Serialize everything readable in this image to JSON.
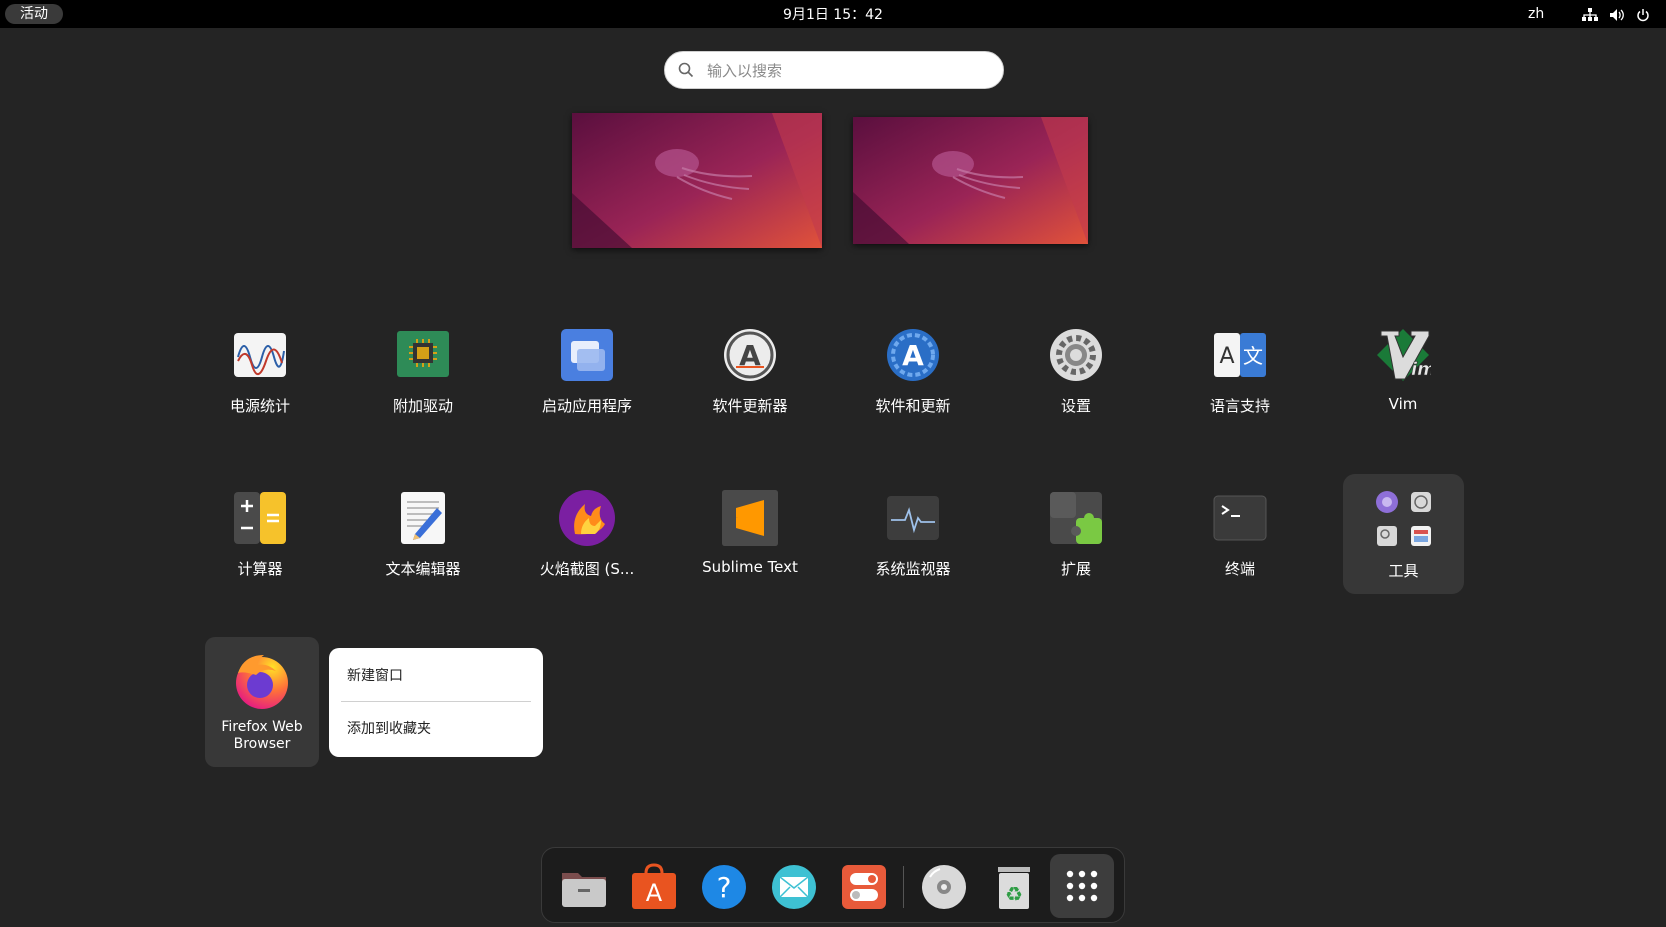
{
  "topbar": {
    "activities": "活动",
    "clock": "9月1日  15：42",
    "language": "zh"
  },
  "search": {
    "placeholder": "输入以搜索"
  },
  "apps": [
    {
      "label": "电源统计",
      "icon": "power-statistics-icon"
    },
    {
      "label": "附加驱动",
      "icon": "additional-drivers-icon"
    },
    {
      "label": "启动应用程序",
      "icon": "startup-applications-icon"
    },
    {
      "label": "软件更新器",
      "icon": "software-updater-icon"
    },
    {
      "label": "软件和更新",
      "icon": "software-updates-icon"
    },
    {
      "label": "设置",
      "icon": "settings-gear-icon"
    },
    {
      "label": "语言支持",
      "icon": "language-support-icon"
    },
    {
      "label": "Vim",
      "icon": "vim-icon"
    },
    {
      "label": "计算器",
      "icon": "calculator-icon"
    },
    {
      "label": "文本编辑器",
      "icon": "text-editor-icon"
    },
    {
      "label": "火焰截图 (S...",
      "icon": "flameshot-icon"
    },
    {
      "label": "Sublime Text",
      "icon": "sublime-text-icon"
    },
    {
      "label": "系统监视器",
      "icon": "system-monitor-icon"
    },
    {
      "label": "扩展",
      "icon": "extensions-icon"
    },
    {
      "label": "终端",
      "icon": "terminal-icon"
    }
  ],
  "folder": {
    "label": "工具"
  },
  "firefox": {
    "label": "Firefox Web Browser"
  },
  "context_menu": {
    "new_window": "新建窗口",
    "add_to_favorites": "添加到收藏夹"
  },
  "dock": {
    "items": [
      "files-icon",
      "app-center-icon",
      "help-icon",
      "mail-icon",
      "settings-toggle-icon",
      "disc-icon",
      "trash-icon",
      "show-apps-icon"
    ]
  },
  "colors": {
    "background": "#242424",
    "topbar": "#000000",
    "accent_orange": "#e95420"
  }
}
